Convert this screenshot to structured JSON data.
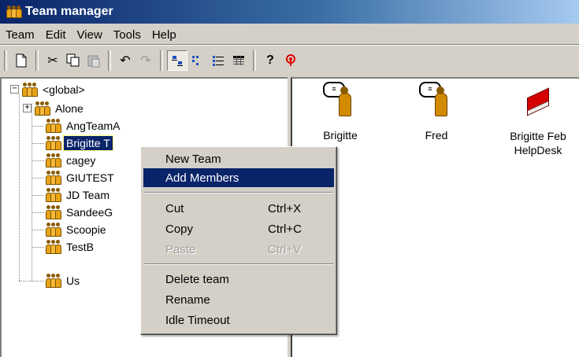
{
  "window": {
    "title": "Team manager",
    "title_icon": "team-icon"
  },
  "menu": [
    "Team",
    "Edit",
    "View",
    "Tools",
    "Help"
  ],
  "toolbar": {
    "buttons": [
      "new-icon",
      "cut-icon",
      "copy-icon",
      "paste-icon",
      "undo-icon",
      "redo-icon",
      "large-icons-icon",
      "small-icons-icon",
      "list-icon",
      "details-icon",
      "help-icon",
      "connection-icon"
    ]
  },
  "tree": {
    "root": "<global>",
    "items": [
      "Alone",
      "AngTeamA",
      "Brigitte T",
      "cagey",
      "GIUTEST",
      "JD Team",
      "SandeeG",
      "Scoopie",
      "TestB",
      "Us"
    ],
    "selected_index": 2
  },
  "right_pane": {
    "items": [
      {
        "label": "Brigitte",
        "icon": "person-chat-icon"
      },
      {
        "label": "Fred",
        "icon": "person-chat-icon"
      },
      {
        "label": "Brigitte Feb HelpDesk",
        "icon": "red-book-icon"
      }
    ]
  },
  "context_menu": {
    "new_team": "New Team",
    "add_members": "Add Members",
    "cut": "Cut",
    "cut_key": "Ctrl+X",
    "copy": "Copy",
    "copy_key": "Ctrl+C",
    "paste": "Paste",
    "paste_key": "Ctrl+V",
    "delete_team": "Delete team",
    "rename": "Rename",
    "idle_timeout": "Idle Timeout"
  },
  "colors": {
    "titlebar": "#0a246a",
    "selection": "#0a246a",
    "face": "#d4d0c8"
  }
}
